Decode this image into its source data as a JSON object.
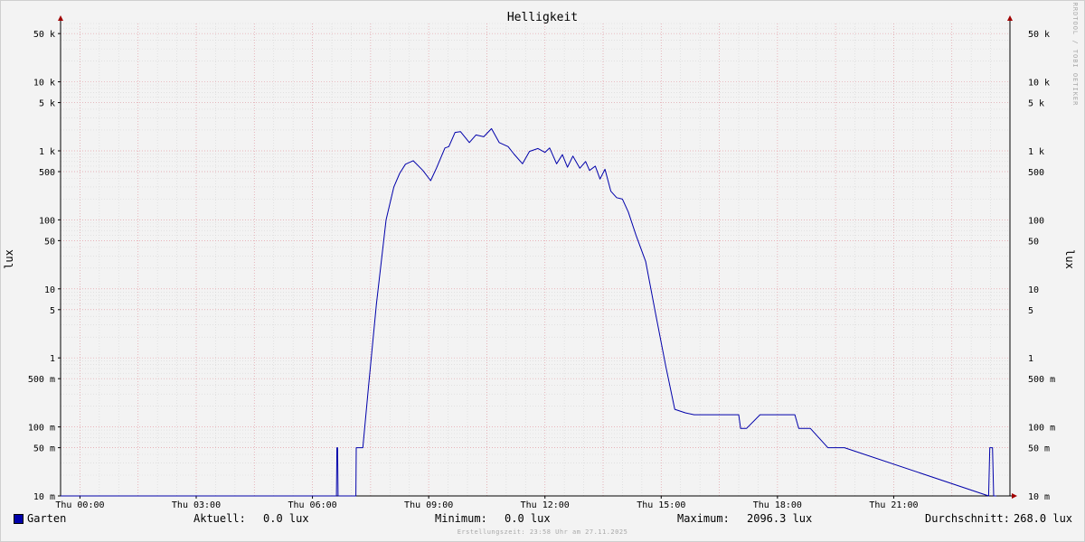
{
  "chart_data": {
    "type": "line",
    "title": "Helligkeit",
    "ylabel": "lux",
    "y_scale": "log",
    "ylim": [
      0.01,
      70000
    ],
    "y_ticks": [
      {
        "value": 50000,
        "label": "50 k"
      },
      {
        "value": 10000,
        "label": "10 k"
      },
      {
        "value": 5000,
        "label": "5 k"
      },
      {
        "value": 1000,
        "label": "1 k"
      },
      {
        "value": 500,
        "label": "500"
      },
      {
        "value": 100,
        "label": "100"
      },
      {
        "value": 50,
        "label": "50"
      },
      {
        "value": 10,
        "label": "10"
      },
      {
        "value": 5,
        "label": "5"
      },
      {
        "value": 1,
        "label": "1"
      },
      {
        "value": 0.5,
        "label": "500 m"
      },
      {
        "value": 0.1,
        "label": "100 m"
      },
      {
        "value": 0.05,
        "label": "50 m"
      },
      {
        "value": 0.01,
        "label": "10 m"
      }
    ],
    "x_ticks": [
      {
        "hour": 0,
        "label": "Thu 00:00"
      },
      {
        "hour": 3,
        "label": "Thu 03:00"
      },
      {
        "hour": 6,
        "label": "Thu 06:00"
      },
      {
        "hour": 9,
        "label": "Thu 09:00"
      },
      {
        "hour": 12,
        "label": "Thu 12:00"
      },
      {
        "hour": 15,
        "label": "Thu 15:00"
      },
      {
        "hour": 18,
        "label": "Thu 18:00"
      },
      {
        "hour": 21,
        "label": "Thu 21:00"
      }
    ],
    "xlim_hours": [
      -0.5,
      24.0
    ],
    "grid": true,
    "series": [
      {
        "name": "Garten",
        "color": "#0000aa",
        "x_hours": [
          -0.5,
          6.62,
          6.63,
          6.65,
          6.66,
          7.12,
          7.13,
          7.3,
          7.45,
          7.65,
          7.9,
          8.1,
          8.25,
          8.4,
          8.6,
          8.85,
          9.05,
          9.2,
          9.42,
          9.52,
          9.68,
          9.82,
          10.05,
          10.22,
          10.42,
          10.62,
          10.82,
          11.05,
          11.2,
          11.42,
          11.6,
          11.82,
          12.0,
          12.12,
          12.3,
          12.45,
          12.58,
          12.72,
          12.9,
          13.05,
          13.15,
          13.3,
          13.42,
          13.55,
          13.7,
          13.85,
          14.0,
          14.15,
          14.35,
          14.6,
          14.85,
          15.12,
          15.35,
          15.62,
          15.85,
          16.05,
          16.22,
          16.4,
          16.58,
          16.75,
          16.9,
          17.0,
          17.05,
          17.2,
          17.55,
          18.45,
          18.55,
          18.6,
          18.68,
          18.75,
          18.85,
          19.3,
          19.72,
          19.73,
          23.45,
          23.48,
          23.55,
          23.58,
          23.65,
          23.68,
          24.0
        ],
        "y_lux": [
          0.0,
          0.0,
          0.05,
          0.05,
          0.0,
          0.0,
          0.05,
          0.05,
          0.4,
          6.0,
          100,
          300,
          470,
          640,
          720,
          520,
          370,
          560,
          1100,
          1150,
          1850,
          1900,
          1320,
          1700,
          1600,
          2096.3,
          1320,
          1150,
          900,
          650,
          980,
          1080,
          950,
          1100,
          650,
          880,
          580,
          840,
          560,
          700,
          520,
          600,
          390,
          540,
          260,
          210,
          200,
          130,
          60,
          25,
          4.5,
          0.75,
          0.18,
          0.16,
          0.15,
          0.15,
          0.15,
          0.15,
          0.15,
          0.15,
          0.15,
          0.15,
          0.095,
          0.095,
          0.15,
          0.15,
          0.095,
          0.095,
          0.095,
          0.095,
          0.095,
          0.05,
          0.05,
          0.05,
          0.0,
          0.05,
          0.05,
          0.0,
          0.0
        ]
      }
    ]
  },
  "legend": {
    "series_name": "Garten",
    "current_label": "Aktuell:",
    "current_value": "0.0 lux",
    "min_label": "Minimum:",
    "min_value": "0.0 lux",
    "max_label": "Maximum:",
    "max_value": "2096.3 lux",
    "avg_label": "Durchschnitt:",
    "avg_value": "268.0 lux"
  },
  "footer": "Erstellungszeit: 23:58 Uhr am 27.11.2025",
  "watermark": "RRDTOOL / TOBI OETIKER"
}
